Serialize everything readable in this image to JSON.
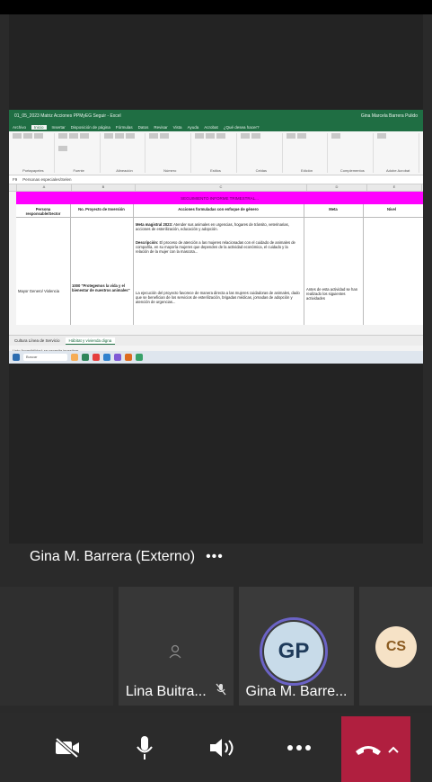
{
  "excel": {
    "title": "01_05_2023 Matriz Acciones PPMyEG Seguir - Excel",
    "user_label": "Gina Marcela Barrera Pulido",
    "menu": [
      "Archivo",
      "Inicio",
      "Insertar",
      "Disposición de página",
      "Fórmulas",
      "Datos",
      "Revisar",
      "Vista",
      "Ayuda",
      "Acrobat",
      "¿Qué desea hacer?"
    ],
    "active_menu": "Inicio",
    "ribbon_groups": [
      "Portapapeles",
      "Fuente",
      "Alineación",
      "Número",
      "Estilos",
      "Celdas",
      "Edición",
      "Complementos",
      "Adobe Acrobat"
    ],
    "formula_ref": "F9",
    "formula_text": "Personas especiales/Selen",
    "columns": [
      "A",
      "B",
      "C",
      "D",
      "E",
      "F"
    ],
    "banner": "SEGUIMIENTO INFORME TRIMESTRAL...",
    "headers": [
      "Persona responsable/Sector",
      "No. Proyecto de Inversión",
      "Acciones formuladas con enfoque de género",
      "Meta",
      "Nivel"
    ],
    "sector": "Mayor Genero/ Violencia",
    "project": "1000 \"Protegemos la vida y el bienestar de nuestros animales\"",
    "meta_heading": "Meta magistral 2023:",
    "meta_text": "Atender sus animales en urgencias, hogares de tránsito, veterinarias, acciones de esterilización, educación y adopción.",
    "desc_heading": "Descripción:",
    "desc_text": "El proceso de atención a las mujeres relacionadas con el cuidado de animales de compañía, en su mayoría mujeres que dependen de la actividad económica, el cuidado y la relación de la mujer con la mascota...",
    "body_text": "La ejecución del proyecto favorece de manera directa a las mujeres cuidadoras de animales, dado que se benefician de los servicios de esterilización, brigadas médicas, jornadas de adopción y atención de urgencias...",
    "meta_col_text": "Antes de esta actividad se han realizado los siguientes actividades",
    "sheet_tabs": [
      "Cultura Línea de Servicio",
      "Hábitat y vivienda digna"
    ],
    "status": "Listo   Accesibilidad: se necesita investigar",
    "search_placeholder": "Buscar"
  },
  "call": {
    "presenter": "Gina M. Barrera (Externo)",
    "more": "•••",
    "participants": [
      {
        "name": "Lina Buitra...",
        "muted": true
      },
      {
        "name": "Gina M. Barre...",
        "initials": "GP"
      },
      {
        "name": "",
        "initials": "CS"
      }
    ]
  },
  "colors": {
    "background": "#2a2a2a",
    "tile": "#373737",
    "hangup": "#b01f3f",
    "excel_green": "#1f6e43",
    "banner": "#ff00ff",
    "avatar_gp": "#c8dbe9",
    "avatar_cs": "#f6e2c6"
  }
}
